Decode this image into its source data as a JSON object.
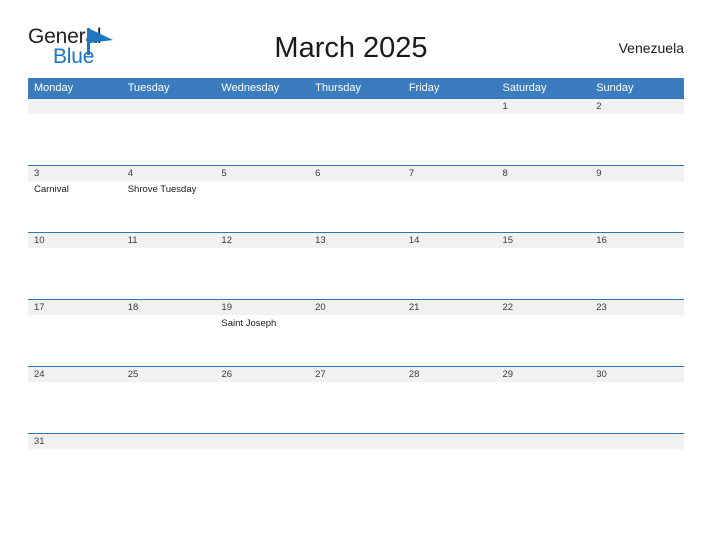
{
  "brand": {
    "name_part1": "General",
    "name_part2": "Blue",
    "flag_icon": "flag-triangle-icon",
    "color_dark": "#231f20",
    "color_blue": "#1f77c4"
  },
  "header": {
    "title": "March 2025",
    "country": "Venezuela"
  },
  "theme": {
    "header_blue": "#3b7cbf",
    "row_divider_blue": "#2e75b6",
    "daynum_strip": "#f1f1f1",
    "page_background": "#ffffff"
  },
  "calendar": {
    "month": "March",
    "year": "2025",
    "weekday_headers": [
      "Monday",
      "Tuesday",
      "Wednesday",
      "Thursday",
      "Friday",
      "Saturday",
      "Sunday"
    ],
    "weeks": [
      [
        {
          "day": "",
          "event": ""
        },
        {
          "day": "",
          "event": ""
        },
        {
          "day": "",
          "event": ""
        },
        {
          "day": "",
          "event": ""
        },
        {
          "day": "",
          "event": ""
        },
        {
          "day": "1",
          "event": ""
        },
        {
          "day": "2",
          "event": ""
        }
      ],
      [
        {
          "day": "3",
          "event": "Carnival"
        },
        {
          "day": "4",
          "event": "Shrove Tuesday"
        },
        {
          "day": "5",
          "event": ""
        },
        {
          "day": "6",
          "event": ""
        },
        {
          "day": "7",
          "event": ""
        },
        {
          "day": "8",
          "event": ""
        },
        {
          "day": "9",
          "event": ""
        }
      ],
      [
        {
          "day": "10",
          "event": ""
        },
        {
          "day": "11",
          "event": ""
        },
        {
          "day": "12",
          "event": ""
        },
        {
          "day": "13",
          "event": ""
        },
        {
          "day": "14",
          "event": ""
        },
        {
          "day": "15",
          "event": ""
        },
        {
          "day": "16",
          "event": ""
        }
      ],
      [
        {
          "day": "17",
          "event": ""
        },
        {
          "day": "18",
          "event": ""
        },
        {
          "day": "19",
          "event": "Saint Joseph"
        },
        {
          "day": "20",
          "event": ""
        },
        {
          "day": "21",
          "event": ""
        },
        {
          "day": "22",
          "event": ""
        },
        {
          "day": "23",
          "event": ""
        }
      ],
      [
        {
          "day": "24",
          "event": ""
        },
        {
          "day": "25",
          "event": ""
        },
        {
          "day": "26",
          "event": ""
        },
        {
          "day": "27",
          "event": ""
        },
        {
          "day": "28",
          "event": ""
        },
        {
          "day": "29",
          "event": ""
        },
        {
          "day": "30",
          "event": ""
        }
      ],
      [
        {
          "day": "31",
          "event": ""
        },
        {
          "day": "",
          "event": ""
        },
        {
          "day": "",
          "event": ""
        },
        {
          "day": "",
          "event": ""
        },
        {
          "day": "",
          "event": ""
        },
        {
          "day": "",
          "event": ""
        },
        {
          "day": "",
          "event": ""
        }
      ]
    ]
  }
}
